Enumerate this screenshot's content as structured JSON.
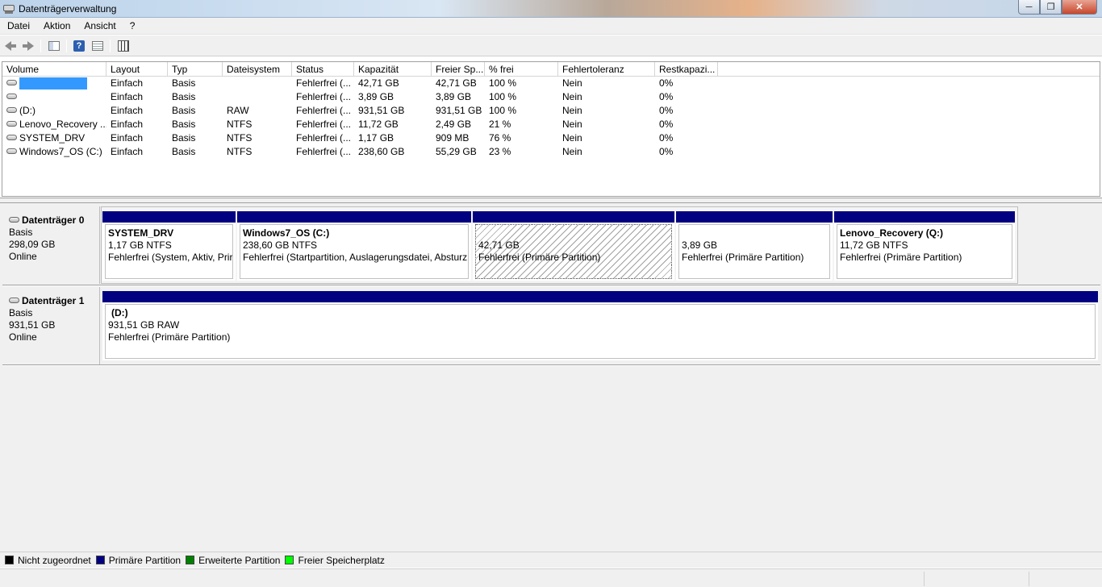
{
  "window": {
    "title": "Datenträgerverwaltung",
    "min": "─",
    "max": "❐",
    "close": "✕"
  },
  "menu": [
    "Datei",
    "Aktion",
    "Ansicht",
    "?"
  ],
  "toolbar": {
    "help": "?"
  },
  "columns": [
    "Volume",
    "Layout",
    "Typ",
    "Dateisystem",
    "Status",
    "Kapazität",
    "Freier Sp...",
    "% frei",
    "Fehlertoleranz",
    "Restkapazi..."
  ],
  "volumes": [
    {
      "name": "",
      "layout": "Einfach",
      "typ": "Basis",
      "fs": "",
      "status": "Fehlerfrei (...",
      "cap": "42,71 GB",
      "free": "42,71 GB",
      "pct": "100 %",
      "ft": "Nein",
      "rest": "0%"
    },
    {
      "name": "",
      "layout": "Einfach",
      "typ": "Basis",
      "fs": "",
      "status": "Fehlerfrei (...",
      "cap": "3,89 GB",
      "free": "3,89 GB",
      "pct": "100 %",
      "ft": "Nein",
      "rest": "0%"
    },
    {
      "name": "(D:)",
      "layout": "Einfach",
      "typ": "Basis",
      "fs": "RAW",
      "status": "Fehlerfrei (...",
      "cap": "931,51 GB",
      "free": "931,51 GB",
      "pct": "100 %",
      "ft": "Nein",
      "rest": "0%"
    },
    {
      "name": "Lenovo_Recovery ...",
      "layout": "Einfach",
      "typ": "Basis",
      "fs": "NTFS",
      "status": "Fehlerfrei (...",
      "cap": "11,72 GB",
      "free": "2,49 GB",
      "pct": "21 %",
      "ft": "Nein",
      "rest": "0%"
    },
    {
      "name": "SYSTEM_DRV",
      "layout": "Einfach",
      "typ": "Basis",
      "fs": "NTFS",
      "status": "Fehlerfrei (...",
      "cap": "1,17 GB",
      "free": "909 MB",
      "pct": "76 %",
      "ft": "Nein",
      "rest": "0%"
    },
    {
      "name": "Windows7_OS (C:)",
      "layout": "Einfach",
      "typ": "Basis",
      "fs": "NTFS",
      "status": "Fehlerfrei (...",
      "cap": "238,60 GB",
      "free": "55,29 GB",
      "pct": "23 %",
      "ft": "Nein",
      "rest": "0%"
    }
  ],
  "disk0": {
    "title": "Datenträger 0",
    "type": "Basis",
    "size": "298,09 GB",
    "state": "Online",
    "partitions": [
      {
        "name": "SYSTEM_DRV",
        "size": "1,17 GB NTFS",
        "status": "Fehlerfrei (System, Aktiv, Prir"
      },
      {
        "name": "Windows7_OS  (C:)",
        "size": "238,60 GB NTFS",
        "status": "Fehlerfrei (Startpartition, Auslagerungsdatei, Absturz"
      },
      {
        "name": "",
        "size": "42,71 GB",
        "status": "Fehlerfrei (Primäre Partition)"
      },
      {
        "name": "",
        "size": "3,89 GB",
        "status": "Fehlerfrei (Primäre Partition)"
      },
      {
        "name": "Lenovo_Recovery  (Q:)",
        "size": "11,72 GB NTFS",
        "status": "Fehlerfrei (Primäre Partition)"
      }
    ]
  },
  "disk1": {
    "title": "Datenträger 1",
    "type": "Basis",
    "size": "931,51 GB",
    "state": "Online",
    "partitions": [
      {
        "name": "(D:)",
        "size": "931,51 GB RAW",
        "status": "Fehlerfrei (Primäre Partition)"
      }
    ]
  },
  "legend": [
    {
      "label": "Nicht zugeordnet",
      "color": "#000000"
    },
    {
      "label": "Primäre Partition",
      "color": "#000080"
    },
    {
      "label": "Erweiterte Partition",
      "color": "#008000"
    },
    {
      "label": "Freier Speicherplatz",
      "color": "#00ff00"
    }
  ]
}
